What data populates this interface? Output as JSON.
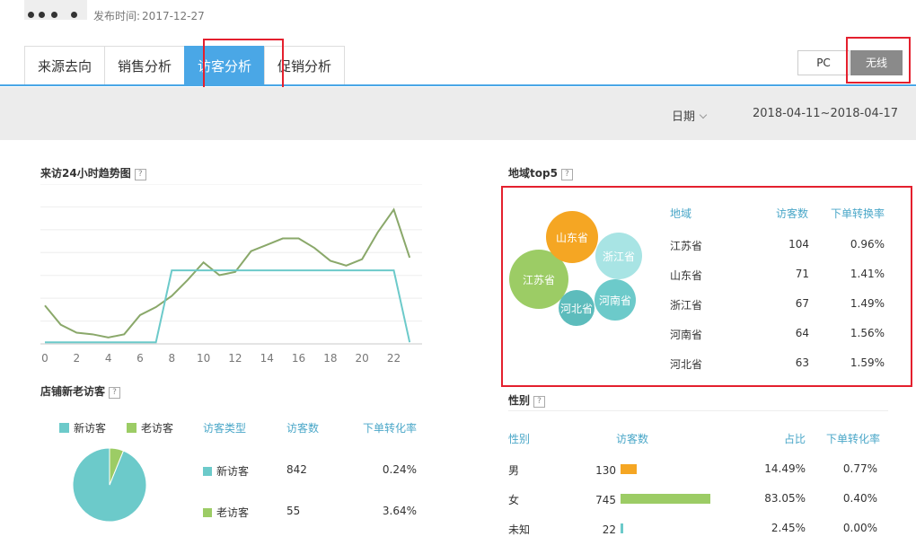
{
  "header": {
    "publish_label": "发布时间:",
    "publish_date": "2017-12-27"
  },
  "tabs": [
    {
      "label": "来源去向"
    },
    {
      "label": "销售分析"
    },
    {
      "label": "访客分析"
    },
    {
      "label": "促销分析"
    }
  ],
  "active_tab": 2,
  "device": {
    "pc_label": "PC",
    "wireless_label": "无线",
    "selected": "无线"
  },
  "filter": {
    "date_label": "日期",
    "date_range": "2018-04-11~2018-04-17"
  },
  "colors": {
    "accent": "#4aa7e6",
    "teal": "#6ccaca",
    "green": "#9ccc65",
    "orange": "#f5a623",
    "highlight": "#e4202e"
  },
  "trend": {
    "title": "来访24小时趋势图",
    "help": "?",
    "x_ticks": [
      "0",
      "2",
      "4",
      "6",
      "8",
      "10",
      "12",
      "14",
      "16",
      "18",
      "20",
      "22"
    ]
  },
  "chart_data": {
    "type": "line",
    "x": [
      0,
      1,
      2,
      3,
      4,
      5,
      6,
      7,
      8,
      9,
      10,
      11,
      12,
      13,
      14,
      15,
      16,
      17,
      18,
      19,
      20,
      21,
      22,
      23
    ],
    "ylim": [
      0,
      100
    ],
    "grid": true,
    "series": [
      {
        "color": "#8aa86a",
        "values": [
          24,
          12,
          7,
          6,
          4,
          6,
          18,
          23,
          30,
          40,
          51,
          43,
          45,
          58,
          62,
          66,
          66,
          60,
          52,
          49,
          53,
          70,
          84,
          54
        ]
      },
      {
        "color": "#6ccaca",
        "values": [
          1,
          1,
          1,
          1,
          1,
          1,
          1,
          1,
          46,
          46,
          46,
          46,
          46,
          46,
          46,
          46,
          46,
          46,
          46,
          46,
          46,
          46,
          46,
          1
        ]
      }
    ]
  },
  "visitors": {
    "title": "店铺新老访客",
    "help": "?",
    "legend": [
      {
        "label": "新访客",
        "color": "#6ccaca"
      },
      {
        "label": "老访客",
        "color": "#9ccc65"
      }
    ],
    "headers": [
      "访客类型",
      "访客数",
      "下单转化率"
    ],
    "rows": [
      {
        "type": "新访客",
        "count": "842",
        "rate": "0.24%",
        "color": "#6ccaca"
      },
      {
        "type": "老访客",
        "count": "55",
        "rate": "3.64%",
        "color": "#9ccc65"
      }
    ],
    "pie": [
      {
        "label": "新访客",
        "value": 842
      },
      {
        "label": "老访客",
        "value": 55
      }
    ]
  },
  "region": {
    "title": "地域top5",
    "help": "?",
    "headers": [
      "地域",
      "访客数",
      "下单转换率"
    ],
    "rows": [
      {
        "name": "江苏省",
        "count": "104",
        "rate": "0.96%"
      },
      {
        "name": "山东省",
        "count": "71",
        "rate": "1.41%"
      },
      {
        "name": "浙江省",
        "count": "67",
        "rate": "1.49%"
      },
      {
        "name": "河南省",
        "count": "64",
        "rate": "1.56%"
      },
      {
        "name": "河北省",
        "count": "63",
        "rate": "1.59%"
      }
    ],
    "bubbles": [
      {
        "label": "江苏省",
        "color": "#9ccc65"
      },
      {
        "label": "山东省",
        "color": "#f5a623"
      },
      {
        "label": "浙江省",
        "color": "#a8e4e4"
      },
      {
        "label": "河南省",
        "color": "#6ccaca"
      },
      {
        "label": "河北省",
        "color": "#5dbcbc"
      }
    ]
  },
  "gender": {
    "title": "性别",
    "help": "?",
    "headers": [
      "性别",
      "访客数",
      "占比",
      "下单转化率"
    ],
    "rows": [
      {
        "gender": "男",
        "count": "130",
        "share": "14.49%",
        "rate": "0.77%",
        "bar_fraction": 0.1449,
        "color": "#f5a623"
      },
      {
        "gender": "女",
        "count": "745",
        "share": "83.05%",
        "rate": "0.40%",
        "bar_fraction": 0.8305,
        "color": "#9ccc65"
      },
      {
        "gender": "未知",
        "count": "22",
        "share": "2.45%",
        "rate": "0.00%",
        "bar_fraction": 0.0245,
        "color": "#6ccaca"
      }
    ]
  }
}
